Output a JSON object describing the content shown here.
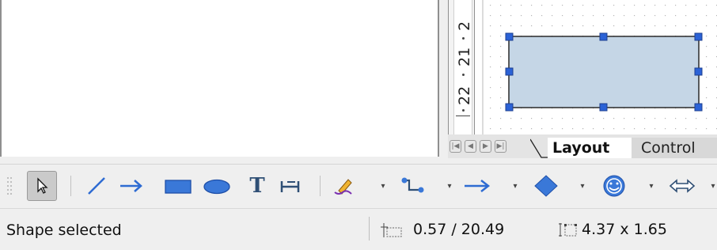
{
  "ruler": {
    "labels": [
      "2",
      "21",
      "22"
    ]
  },
  "tabs": {
    "layout_label": "Layout",
    "controls_label": "Control"
  },
  "toolbar": {
    "items": [
      "select-icon",
      "line-icon",
      "arrow-icon",
      "rectangle-icon",
      "ellipse-icon",
      "text-icon",
      "connector-icon",
      "freeform-icon",
      "connectors-icon",
      "lines-arrows-icon",
      "basic-shapes-icon",
      "symbol-shapes-icon",
      "block-arrows-icon"
    ],
    "text_tool_label": "T"
  },
  "statusbar": {
    "message": "Shape selected",
    "position": "0.57 / 20.49",
    "size": "4.37 x 1.65"
  },
  "colors": {
    "shape_fill": "#c5d6e6",
    "handle": "#2b62d6",
    "accent_blue": "#2e6bd2",
    "shape_icon_blue": "#3a78d8"
  }
}
